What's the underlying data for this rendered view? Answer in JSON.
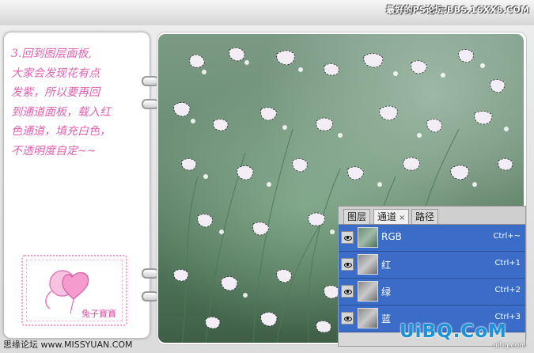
{
  "header": {
    "watermark": "最好的PS论坛:BBS.16XX8.COM"
  },
  "note": {
    "lines": [
      "3.回到图层面板,",
      "大家会发现花有点",
      "发紫，所以要再回",
      "到通道面板，载入红",
      "色通道，填充白色，",
      "不透明度自定~~"
    ],
    "color": "#e062b2"
  },
  "stamp": {
    "label": "兔子寶寶"
  },
  "channels_panel": {
    "tabs": [
      {
        "label": "图层"
      },
      {
        "label": "通道"
      },
      {
        "label": "路径"
      }
    ],
    "close_glyph": "×",
    "rows": [
      {
        "name": "RGB",
        "shortcut": "Ctrl+~"
      },
      {
        "name": "红",
        "shortcut": "Ctrl+1"
      },
      {
        "name": "绿",
        "shortcut": "Ctrl+2"
      },
      {
        "name": "蓝",
        "shortcut": "Ctrl+3"
      }
    ],
    "selected_color": "#3b6cc8"
  },
  "footer": {
    "text": "思缘论坛 www.MISSYUAN.COM"
  },
  "brand": {
    "name": "UiBQ.CoM",
    "sub": "uibq.com"
  }
}
